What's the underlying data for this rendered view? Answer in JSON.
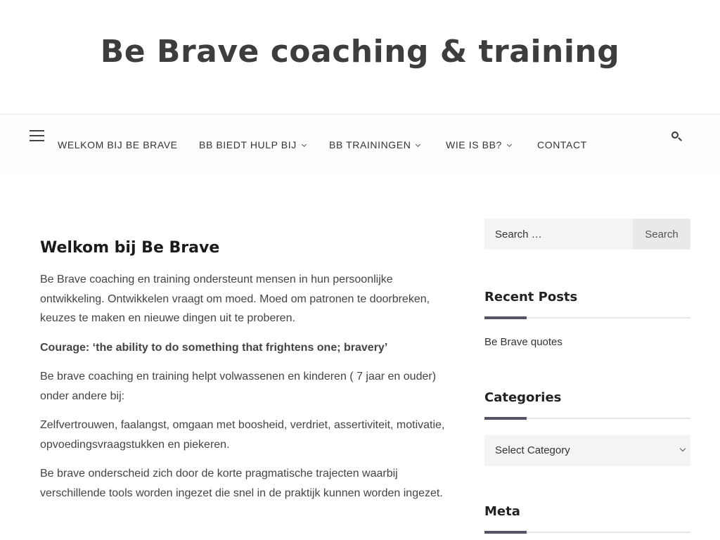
{
  "site": {
    "title": "Be Brave coaching & training"
  },
  "nav": {
    "items": [
      {
        "label": "WELKOM BIJ BE BRAVE",
        "has_submenu": false
      },
      {
        "label": "BB BIEDT HULP BIJ",
        "has_submenu": true
      },
      {
        "label": "BB TRAININGEN",
        "has_submenu": true
      },
      {
        "label": "WIE IS BB?",
        "has_submenu": true
      },
      {
        "label": "CONTACT",
        "has_submenu": false
      }
    ]
  },
  "post": {
    "title": "Welkom bij Be Brave",
    "paragraphs": [
      "Be Brave coaching en training ondersteunt mensen in hun persoonlijke ontwikkeling. Ontwikkelen vraagt om moed. Moed om patronen te doorbreken, keuzes te maken en nieuwe dingen uit te proberen.",
      "Courage: ‘the ability to do something that frightens one; bravery’",
      "Be brave coaching en training helpt volwassenen en kinderen ( 7 jaar en ouder) onder andere bij:",
      "Zelfvertrouwen, faalangst, omgaan met boosheid, verdriet, assertiviteit, motivatie, opvoedingsvraagstukken en piekeren.",
      "Be brave onderscheid zich door de korte pragmatische trajecten waarbij verschillende tools worden ingezet die snel in de praktijk kunnen worden ingezet."
    ]
  },
  "sidebar": {
    "search": {
      "placeholder": "Search …",
      "button": "Search"
    },
    "recent_posts": {
      "title": "Recent Posts",
      "items": [
        "Be Brave quotes"
      ]
    },
    "categories": {
      "title": "Categories",
      "select_label": "Select Category"
    },
    "meta": {
      "title": "Meta"
    }
  },
  "colors": {
    "accent": "#555566",
    "text": "#444444",
    "title": "#3d3d3d"
  }
}
